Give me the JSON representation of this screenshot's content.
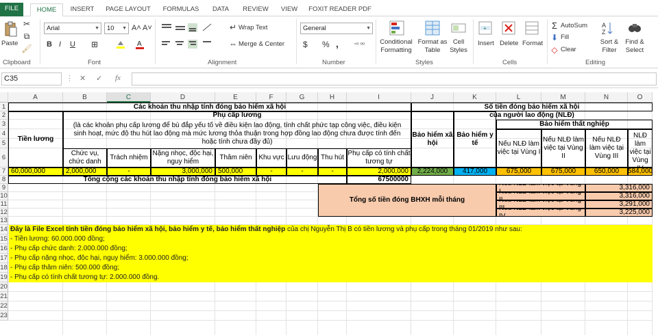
{
  "tabs": [
    "FILE",
    "HOME",
    "INSERT",
    "PAGE LAYOUT",
    "FORMULAS",
    "DATA",
    "REVIEW",
    "VIEW",
    "FOXIT READER PDF"
  ],
  "ribbon": {
    "clipboard": {
      "paste": "Paste",
      "label": "Clipboard"
    },
    "font": {
      "name": "Arial",
      "size": "10",
      "label": "Font",
      "bold": "B",
      "italic": "I",
      "underline": "U",
      "grow": "A˄",
      "shrink": "A˅"
    },
    "alignment": {
      "wrap": "Wrap Text",
      "merge": "Merge & Center",
      "label": "Alignment"
    },
    "number": {
      "format": "General",
      "label": "Number",
      "currency": "$",
      "percent": "%",
      "comma": ","
    },
    "styles": {
      "conditional": "Conditional Formatting",
      "format_table": "Format as Table",
      "cell_styles": "Cell Styles",
      "label": "Styles"
    },
    "cells": {
      "insert": "Insert",
      "delete": "Delete",
      "format": "Format",
      "label": "Cells"
    },
    "editing": {
      "autosum": "AutoSum",
      "fill": "Fill",
      "clear": "Clear",
      "sort": "Sort & Filter",
      "find": "Find & Select",
      "label": "Editing"
    }
  },
  "formula_bar": {
    "name_box": "C35",
    "fx": "fx",
    "value": ""
  },
  "columns": [
    "A",
    "B",
    "C",
    "D",
    "E",
    "F",
    "G",
    "H",
    "I",
    "J",
    "K",
    "L",
    "M",
    "N",
    "O"
  ],
  "rows": [
    "1",
    "2",
    "3",
    "4",
    "5",
    "6",
    "7",
    "8",
    "9",
    "10",
    "11",
    "12",
    "13",
    "14",
    "15",
    "16",
    "17",
    "18",
    "19",
    "20",
    "21",
    "22",
    "23"
  ],
  "sheet": {
    "title_left": "Các khoản thu nhập tính đóng bảo hiểm xã hội",
    "title_right_1": "Số tiền đóng bảo hiểm xã hội",
    "title_right_2": "của người lao động (NLĐ)",
    "tien_luong": "Tiền lương",
    "phu_cap": "Phụ cấp lương",
    "phu_cap_desc": "(là các khoản phụ cấp lương để bù đắp yếu tố về điều kiện lao động, tính chất phức tạp công việc, điều kiện sinh hoạt, mức độ thu hút lao động mà mức lương thỏa thuận trong hợp đồng lao động chưa được tính đến hoặc tính chưa đầy đủ)",
    "sub_headers": [
      "Chức vụ, chức danh",
      "Trách nhiệm",
      "Nặng nhọc, độc hại, nguy hiểm",
      "Thâm niên",
      "Khu vực",
      "Lưu động",
      "Thu hút",
      "Phụ cấp có tính chất tương tự"
    ],
    "bhxh": "Bảo hiểm xã hội",
    "bhyt": "Bảo hiểm y tế",
    "bhtn": "Bảo hiểm thất nghiệp",
    "vung_headers": [
      "Nếu NLĐ làm việc tại Vùng I",
      "Nếu NLĐ làm việc tại Vùng II",
      "Nếu NLĐ làm việc tại Vùng III",
      "Nếu NLĐ làm việc tại Vùng IV"
    ],
    "row7": [
      "60,000,000",
      "2,000,000",
      "-",
      "3,000,000",
      "500,000",
      "-",
      "-",
      "-",
      "2,000,000",
      "2,224,000",
      "417,000",
      "675,000",
      "675,000",
      "650,000",
      "584,000"
    ],
    "total_label": "Tổng cộng các khoản thu nhập tính đóng bảo hiểm xã hội",
    "total_value": "67500000",
    "tong_bhxh_label": "Tổng số tiền đóng BHXH mỗi tháng",
    "vung_rows": [
      {
        "label": "Nếu NLĐ làm việc tại Vùng I",
        "value": "3,316,000"
      },
      {
        "label": "Nếu NLĐ làm việc tại Vùng II",
        "value": "3,316,000"
      },
      {
        "label": "Nếu NLĐ làm việc tại Vùng III",
        "value": "3,291,000"
      },
      {
        "label": "Nếu NLĐ làm việc tại Vùng IV",
        "value": "3,225,000"
      }
    ],
    "note_bold": "Đây là File Excel tính tiền đóng bảo hiểm xã hội, bảo hiểm y tế, bảo hiểm thất nghiệp",
    "note_rest": " của chị Nguyễn Thị B có tiền lương và phụ cấp trong tháng 01/2019 như sau:",
    "notes": [
      "- Tiền lương: 60.000.000 đồng;",
      "- Phụ cấp chức danh: 2.000.000 đồng;",
      "- Phụ cấp nặng nhọc, độc hại, nguy hiểm: 3.000.000 đồng;",
      "- Phụ cấp thâm niên: 500.000 đồng;",
      "- Phụ cấp có tính chất tương tự: 2.000.000 đồng."
    ]
  },
  "colors": {
    "excel_green": "#217346",
    "yellow": "#ffff00",
    "peach": "#f8cbad",
    "green": "#70ad47",
    "blue": "#00b0f0",
    "orange": "#ffc000"
  }
}
